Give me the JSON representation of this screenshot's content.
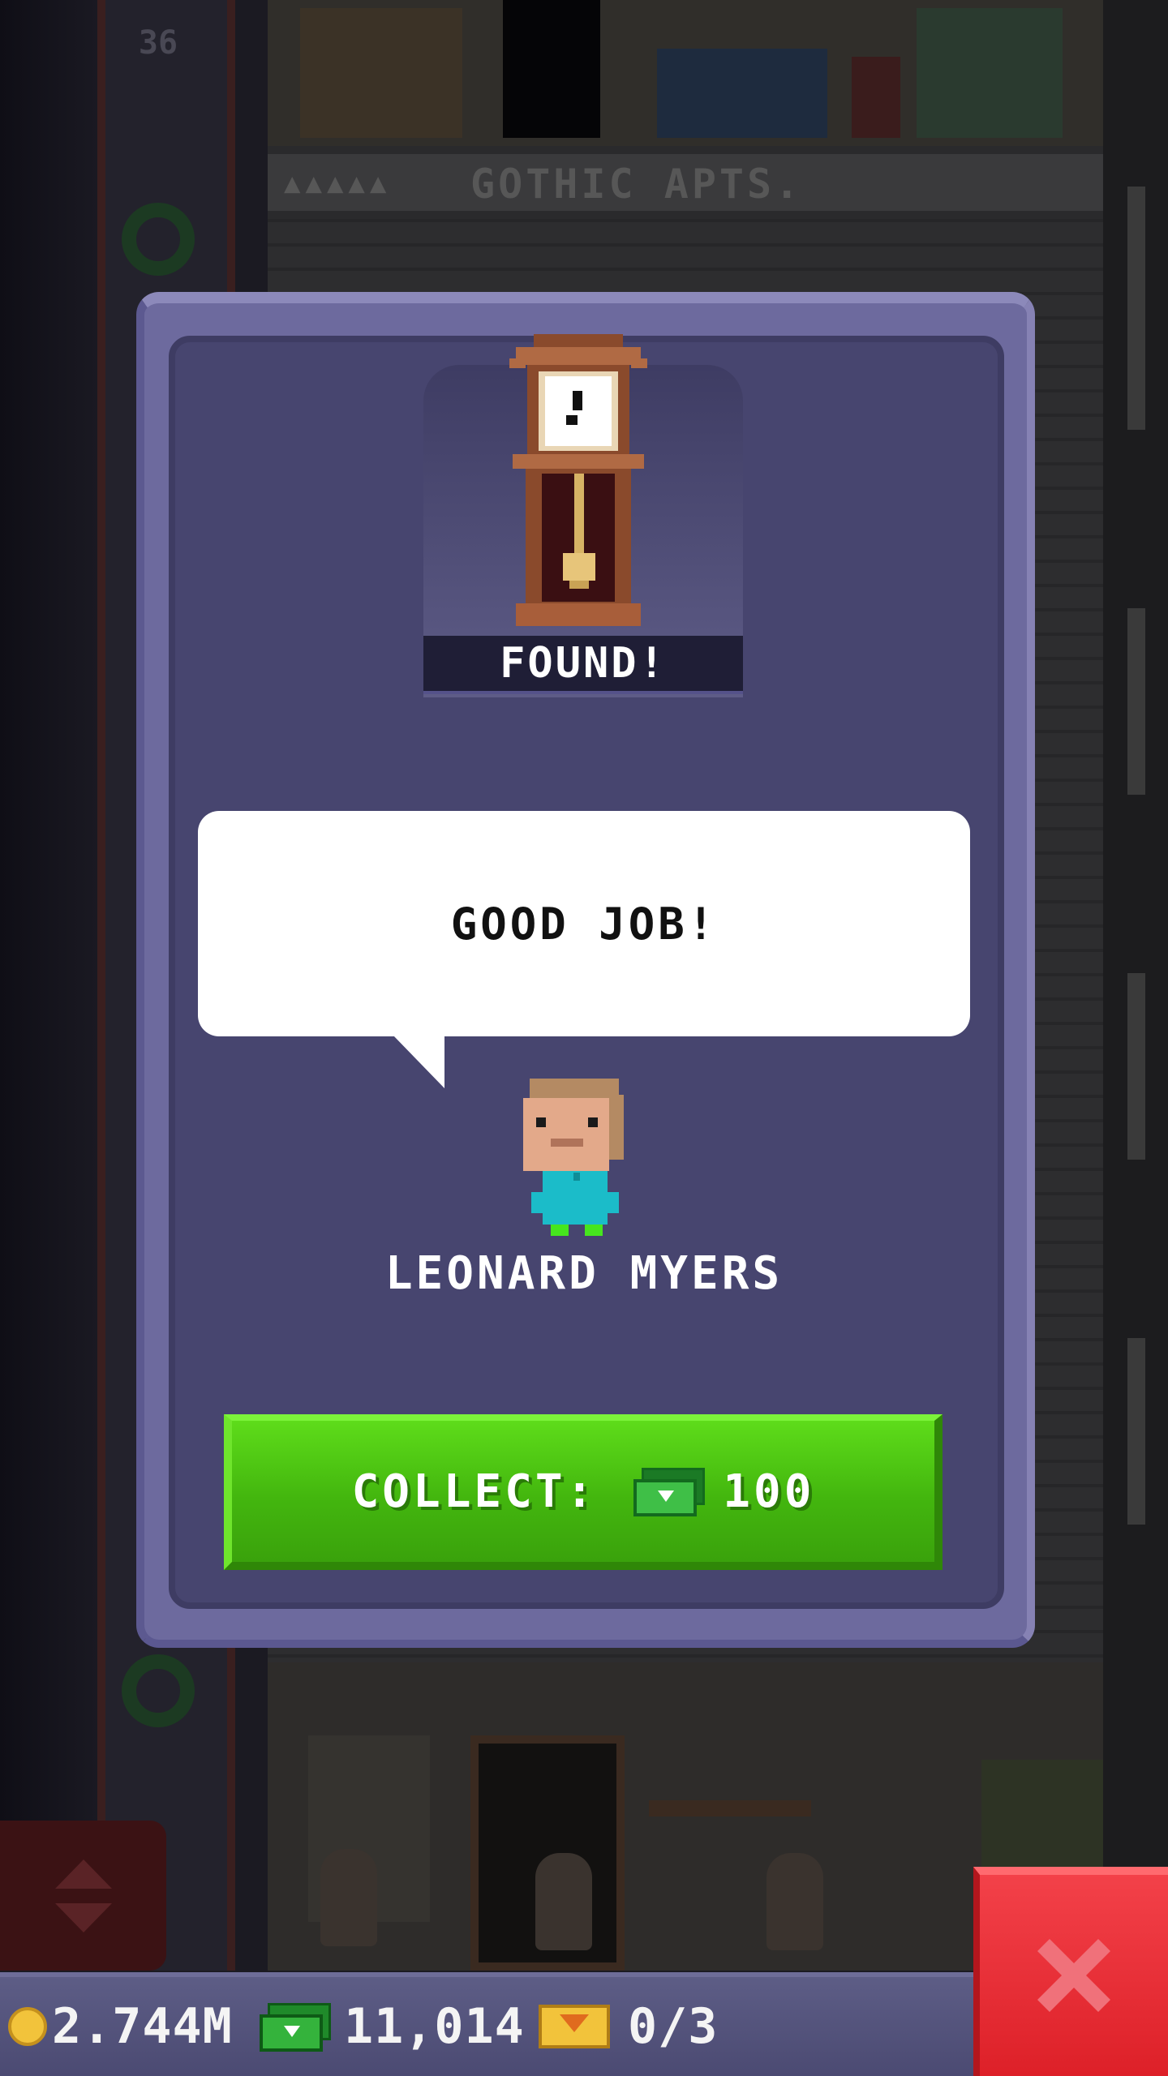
{
  "background": {
    "floor_number": "36",
    "floor_name": "GOTHIC APTS.",
    "floor_rating_icons": "▲▲▲▲▲"
  },
  "modal": {
    "found_label": "FOUND!",
    "item_icon": "grandfather-clock-icon",
    "speech": "GOOD JOB!",
    "character_name": "LEONARD MYERS",
    "collect_label": "COLLECT:",
    "collect_amount": "100",
    "collect_currency_icon": "tower-bux-icon"
  },
  "status_bar": {
    "coins": "2.744M",
    "bux": "11,014",
    "tickets": "0/3"
  },
  "colors": {
    "modal_border": "#6d6a9e",
    "modal_fill": "#47456f",
    "collect_green": "#4fc816",
    "close_red": "#e8262e",
    "coin_gold": "#f2c33b"
  }
}
